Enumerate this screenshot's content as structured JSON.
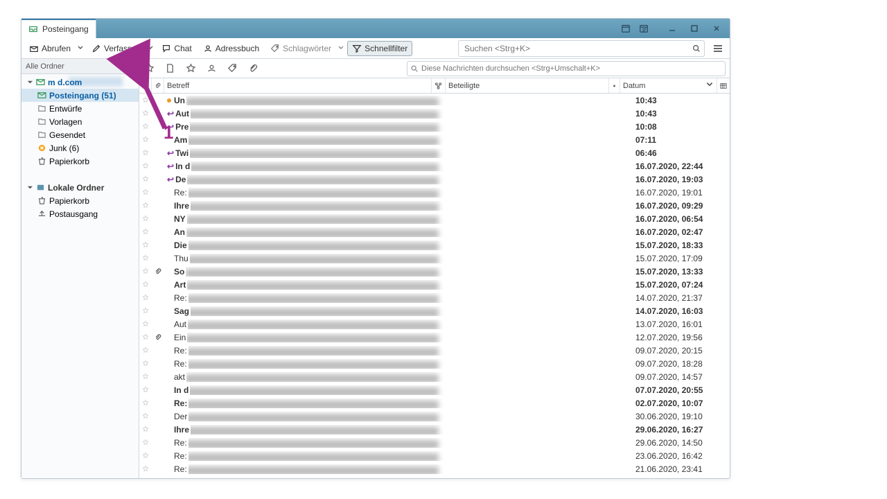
{
  "tab": {
    "title": "Posteingang"
  },
  "toolbar": {
    "abrufen": "Abrufen",
    "verfassen": "Verfassen",
    "chat": "Chat",
    "adressbuch": "Adressbuch",
    "schlagworter": "Schlagwörter",
    "schnellfilter": "Schnellfilter"
  },
  "search": {
    "placeholder": "Suchen <Strg+K>"
  },
  "folderpane": {
    "header": "Alle Ordner",
    "account_visible": "m                         d.com",
    "folders": [
      {
        "label": "Posteingang (51)",
        "selected": true
      },
      {
        "label": "Entwürfe"
      },
      {
        "label": "Vorlagen"
      },
      {
        "label": "Gesendet"
      },
      {
        "label": "Junk (6)",
        "junk": true
      },
      {
        "label": "Papierkorb"
      },
      {
        "label": "",
        "blurred": true
      }
    ],
    "local_header": "Lokale Ordner",
    "local_folders": [
      {
        "label": "Papierkorb"
      },
      {
        "label": "Postausgang"
      }
    ]
  },
  "qf_search": {
    "placeholder": "Diese Nachrichten durchsuchen <Strg+Umschalt+K>"
  },
  "columns": {
    "subject": "Betreff",
    "correspondents": "Beteiligte",
    "date": "Datum"
  },
  "messages": [
    {
      "prefix": "Un",
      "date": "10:43",
      "unread": true,
      "new": true
    },
    {
      "prefix": "Aut",
      "date": "10:43",
      "unread": true,
      "reply": true,
      "thread": true
    },
    {
      "prefix": "Pre",
      "date": "10:08",
      "unread": true,
      "reply": true
    },
    {
      "prefix": "Am",
      "date": "07:11",
      "unread": true
    },
    {
      "prefix": "Twi",
      "date": "06:46",
      "unread": true,
      "reply": true,
      "thread": true
    },
    {
      "prefix": "In d",
      "date": "16.07.2020, 22:44",
      "unread": true,
      "reply": true
    },
    {
      "prefix": "De",
      "date": "16.07.2020, 19:03",
      "unread": true,
      "reply": true
    },
    {
      "prefix": "Re:",
      "date": "16.07.2020, 19:01"
    },
    {
      "prefix": "Ihre",
      "date": "16.07.2020, 09:29",
      "unread": true
    },
    {
      "prefix": "NY",
      "date": "16.07.2020, 06:54",
      "unread": true
    },
    {
      "prefix": "An",
      "date": "16.07.2020, 02:47",
      "unread": true
    },
    {
      "prefix": "Die",
      "date": "15.07.2020, 18:33",
      "unread": true
    },
    {
      "prefix": "Thu",
      "date": "15.07.2020, 17:09"
    },
    {
      "prefix": "So",
      "date": "15.07.2020, 13:33",
      "unread": true,
      "attach": true,
      "thread": true
    },
    {
      "prefix": "Art",
      "date": "15.07.2020, 07:24",
      "unread": true
    },
    {
      "prefix": "Re:",
      "date": "14.07.2020, 21:37"
    },
    {
      "prefix": "Sag",
      "date": "14.07.2020, 16:03",
      "unread": true
    },
    {
      "prefix": "Aut",
      "date": "13.07.2020, 16:01"
    },
    {
      "prefix": "Ein",
      "date": "12.07.2020, 19:56",
      "attach": true
    },
    {
      "prefix": "Re:",
      "date": "09.07.2020, 20:15"
    },
    {
      "prefix": "Re:",
      "date": "09.07.2020, 18:28"
    },
    {
      "prefix": "akt",
      "date": "09.07.2020, 14:57"
    },
    {
      "prefix": "In d",
      "date": "07.07.2020, 20:55",
      "unread": true,
      "thread": true
    },
    {
      "prefix": "Re:",
      "date": "02.07.2020, 10:07",
      "unread": true
    },
    {
      "prefix": "Der",
      "date": "30.06.2020, 19:10"
    },
    {
      "prefix": "Ihre",
      "date": "29.06.2020, 16:27",
      "unread": true
    },
    {
      "prefix": "Re:",
      "date": "29.06.2020, 14:50"
    },
    {
      "prefix": "Re:",
      "date": "23.06.2020, 16:42"
    },
    {
      "prefix": "Re:",
      "date": "21.06.2020, 23:41"
    }
  ],
  "annotation": {
    "number": "1"
  }
}
